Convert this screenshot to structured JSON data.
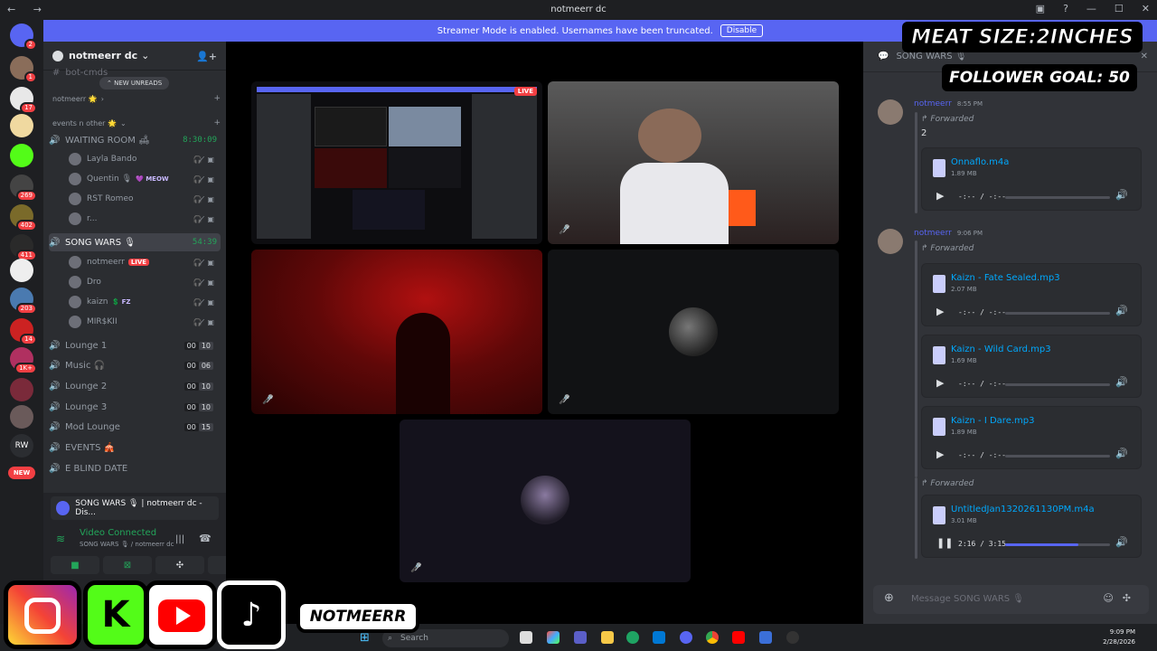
{
  "window": {
    "title": "notmeerr dc"
  },
  "banner": {
    "text": "Streamer Mode is enabled. Usernames have been truncated.",
    "button": "Disable"
  },
  "servers": [
    {
      "label": "",
      "badge": "2",
      "color": "#5865f2"
    },
    {
      "label": "",
      "badge": "1",
      "color": "#8a6d5a"
    },
    {
      "label": "",
      "badge": "17",
      "color": "#e8e8e8"
    },
    {
      "label": "",
      "badge": "",
      "color": "#f0d9a0"
    },
    {
      "label": "",
      "badge": "",
      "color": "#53fc18"
    },
    {
      "label": "",
      "badge": "269",
      "color": "#444"
    },
    {
      "label": "",
      "badge": "402",
      "color": "#7a6a2a"
    },
    {
      "label": "",
      "badge": "411",
      "color": "#2a2a2a"
    },
    {
      "label": "",
      "badge": "",
      "color": "#eee"
    },
    {
      "label": "",
      "badge": "203",
      "color": "#4a7ab0"
    },
    {
      "label": "",
      "badge": "14",
      "color": "#c22"
    },
    {
      "label": "",
      "badge": "1K+",
      "color": "#b03060"
    },
    {
      "label": "",
      "badge": "",
      "color": "#7a2a3a"
    },
    {
      "label": "",
      "badge": "",
      "color": "#6a5a5a"
    },
    {
      "label": "RW",
      "badge": "",
      "color": "#2b2d31"
    },
    {
      "label": "NEW",
      "badge": "",
      "color": "#f23f43"
    }
  ],
  "sidebar": {
    "guild_name": "notmeerr dc",
    "top_channel": "bot-cmds",
    "new_unreads": "NEW UNREADS",
    "cat1": "notmeerr 🌟",
    "cat2": "events n other 🌟",
    "waiting_room": {
      "name": "WAITING ROOM 🛋",
      "timer": "8:30:09"
    },
    "waiting_users": [
      {
        "name": "Layla Bando",
        "tag": ""
      },
      {
        "name": "Quentin 🎙",
        "tag": "💜 MEOW"
      },
      {
        "name": "RST Romeo",
        "tag": ""
      },
      {
        "name": "r...",
        "tag": ""
      }
    ],
    "song_wars": {
      "name": "SONG WARS 🎙",
      "timer": "54:39"
    },
    "song_users": [
      {
        "name": "notmeerr",
        "tag": "LIVE"
      },
      {
        "name": "Dro",
        "tag": ""
      },
      {
        "name": "kaizn",
        "tag": "💲 FZ"
      },
      {
        "name": "MIR$KII",
        "tag": ""
      }
    ],
    "lounges": [
      {
        "name": "Lounge 1",
        "a": "00",
        "b": "10"
      },
      {
        "name": "Music 🎧",
        "a": "00",
        "b": "06"
      },
      {
        "name": "Lounge 2",
        "a": "00",
        "b": "10"
      },
      {
        "name": "Lounge 3",
        "a": "00",
        "b": "10"
      },
      {
        "name": "Mod Lounge",
        "a": "00",
        "b": "15"
      }
    ],
    "events": "EVENTS 🎪",
    "blind_date": "E BLIND DATE"
  },
  "voice": {
    "activity": "SONG WARS 🎙 | notmeerr dc - Dis...",
    "status": "Video Connected",
    "channel": "SONG WARS 🎙 / notmeerr dc"
  },
  "right_panel": {
    "header": "SONG WARS 🎙",
    "messages": [
      {
        "author": "notmeerr",
        "time": "8:55 PM",
        "forwarded": "Forwarded",
        "text": "2"
      },
      {
        "author": "notmeerr",
        "time": "9:06 PM",
        "forwarded": "Forwarded"
      }
    ],
    "attachments": [
      {
        "name": "Onnaflo.m4a",
        "size": "1.89 MB",
        "time": "-:-- / -:--",
        "progress": 0
      },
      {
        "name": "Kaizn - Fate Sealed.mp3",
        "size": "2.07 MB",
        "time": "-:-- / -:--",
        "progress": 0
      },
      {
        "name": "Kaizn - Wild Card.mp3",
        "size": "1.69 MB",
        "time": "-:-- / -:--",
        "progress": 0
      },
      {
        "name": "Kaizn - I Dare.mp3",
        "size": "1.89 MB",
        "time": "-:-- / -:--",
        "progress": 0
      },
      {
        "name": "UntitledJan1320261130PM.m4a",
        "size": "3.01 MB",
        "time": "2:16 / 3:15",
        "progress": 0.7
      }
    ],
    "forwarded3": "Forwarded",
    "composer_placeholder": "Message SONG WARS 🎙"
  },
  "overlay": {
    "meat": "MEAT SIZE:2INCHES",
    "goal": "FOLLOWER GOAL: 50",
    "handle": "NOTMEERR"
  },
  "taskbar": {
    "search": "Search",
    "time": "9:09 PM",
    "date": "2/28/2026"
  },
  "colors": {
    "accent": "#5865f2",
    "live": "#f23f43",
    "green": "#23a55a"
  }
}
